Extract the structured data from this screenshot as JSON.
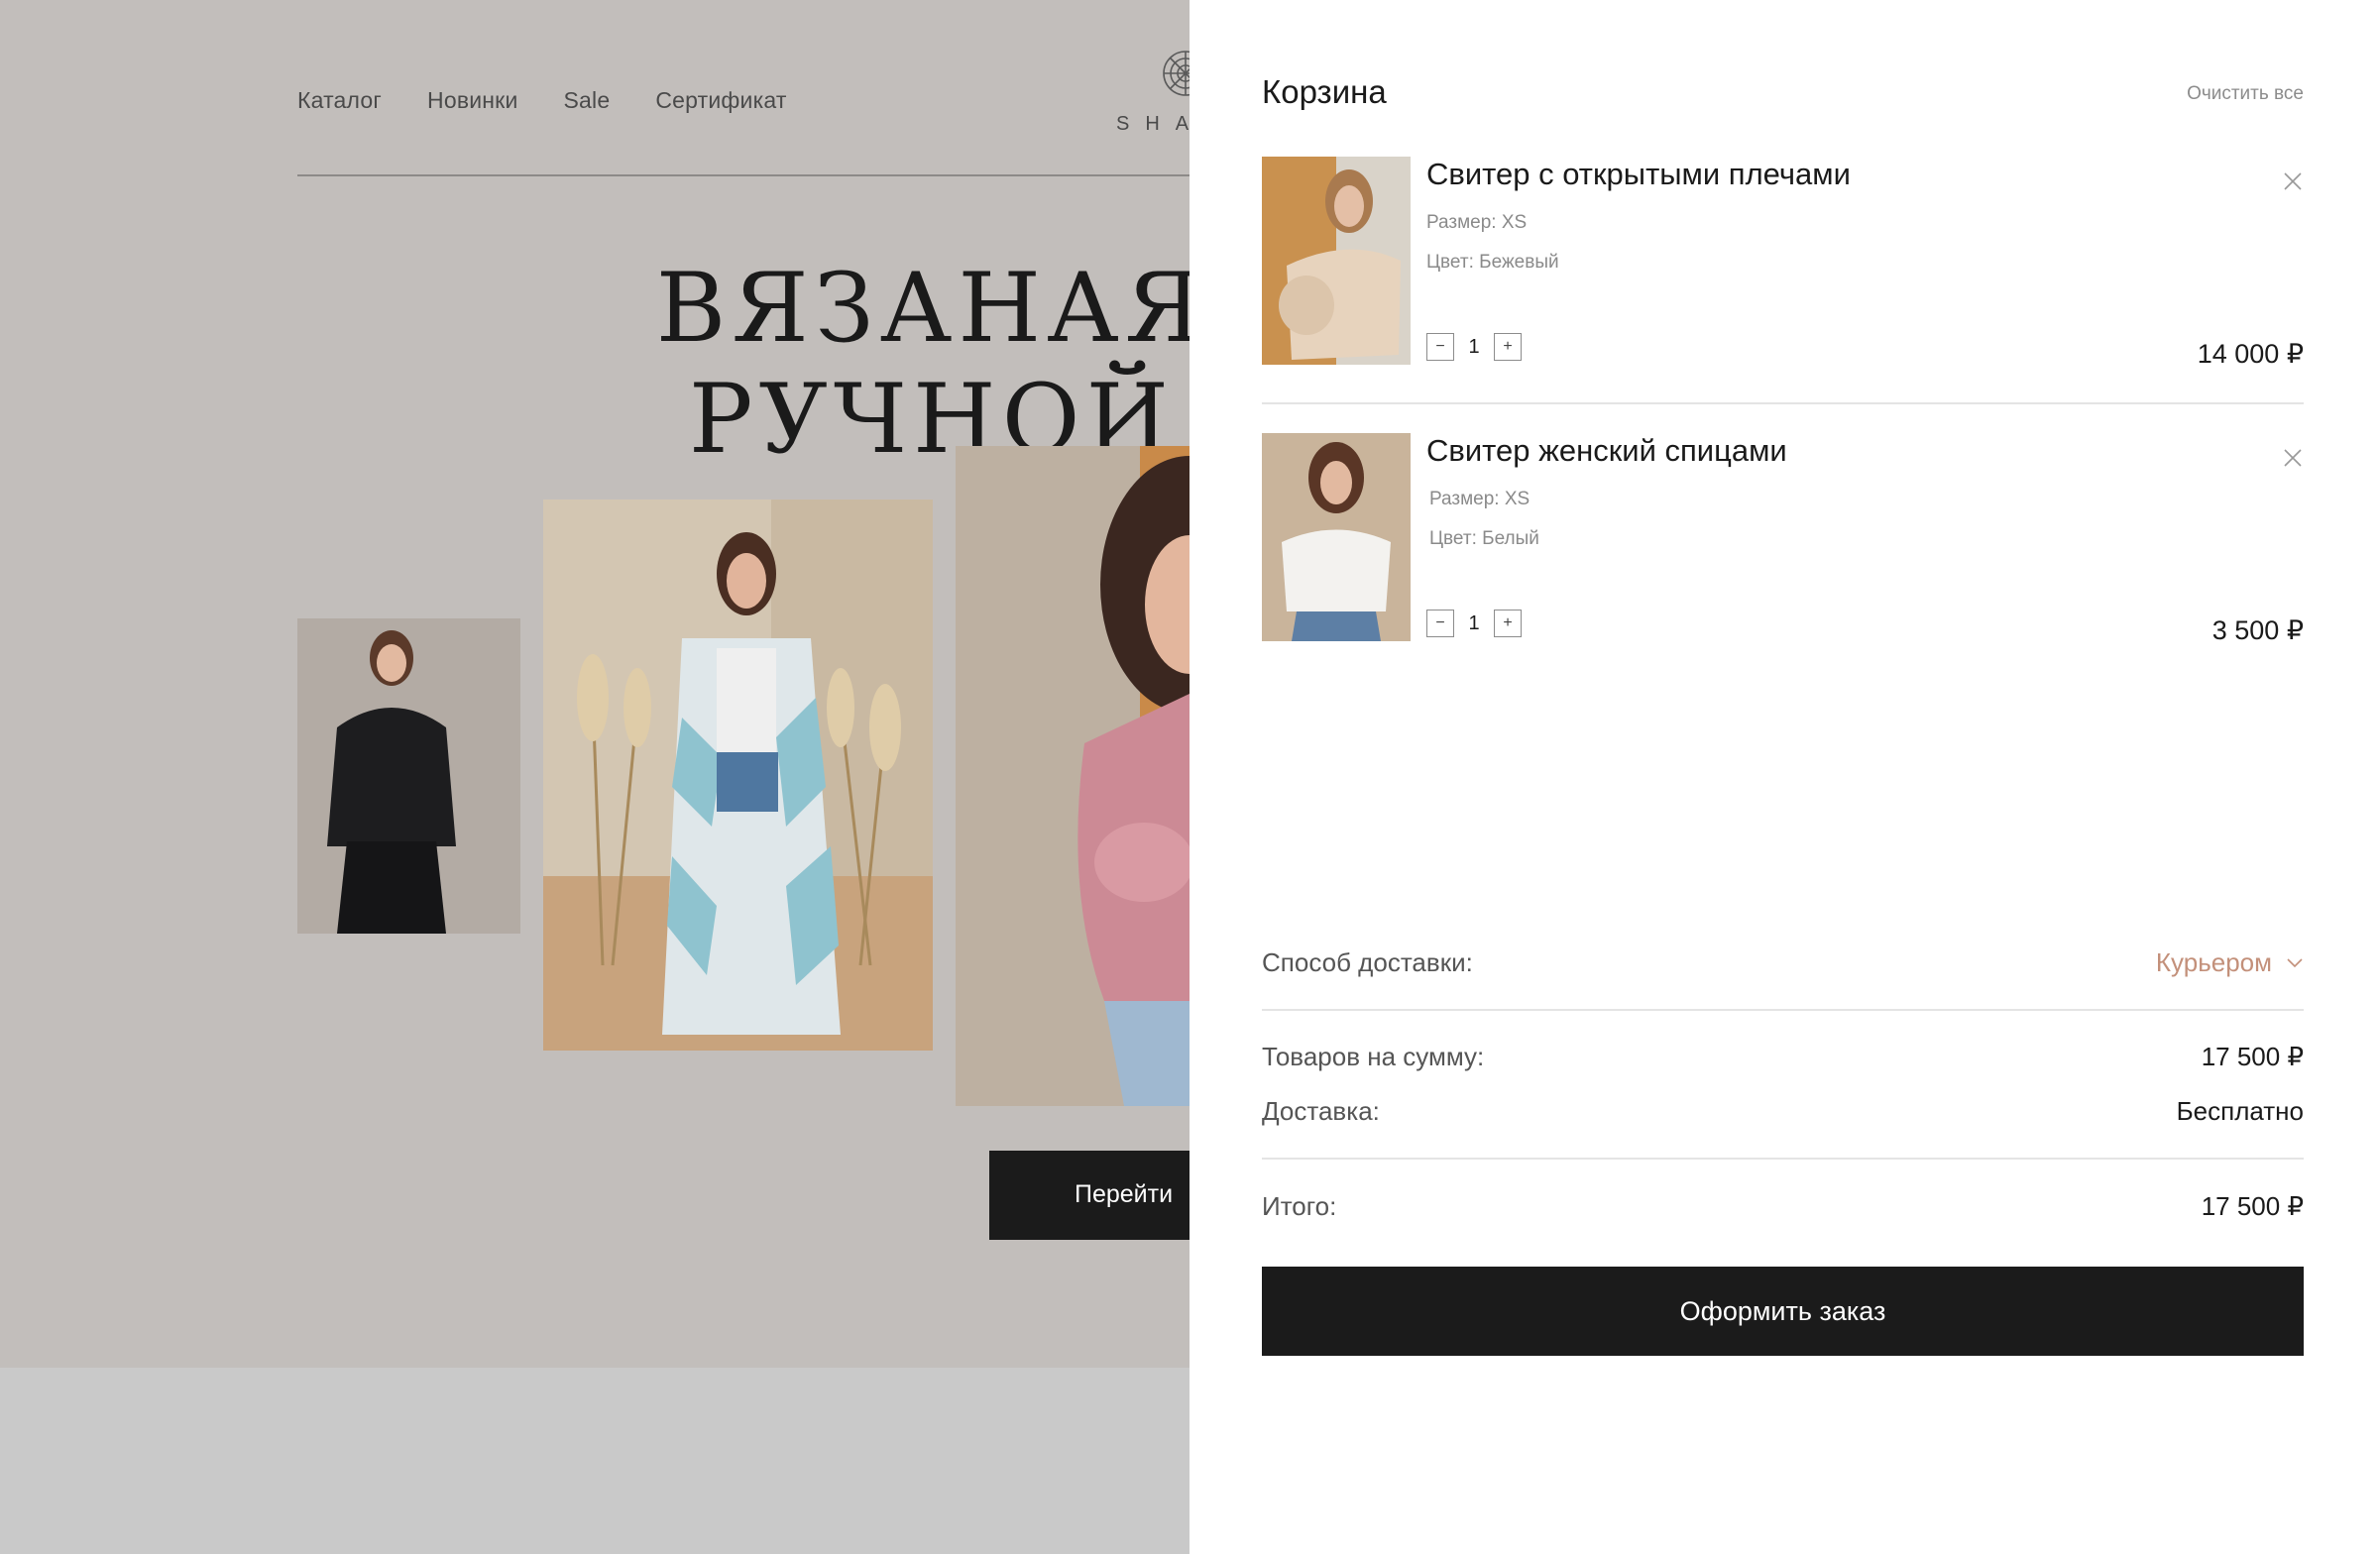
{
  "nav": {
    "items": [
      "Каталог",
      "Новинки",
      "Sale",
      "Сертификат"
    ]
  },
  "brand": {
    "logo_text": "SHA"
  },
  "hero": {
    "line1": "ВЯЗАНАЯ",
    "line2": "РУЧНОЙ",
    "cta": "Перейти"
  },
  "cart": {
    "title": "Корзина",
    "clear_all": "Очистить все",
    "items": [
      {
        "name": "Свитер с открытыми плечами",
        "size": "Размер: XS",
        "color": "Цвет: Бежевый",
        "qty": "1",
        "price": "14 000 ₽"
      },
      {
        "name": "Свитер женский спицами",
        "size": "Размер: XS",
        "color": "Цвет: Белый",
        "qty": "1",
        "price": "3 500 ₽"
      }
    ],
    "qty_minus": "−",
    "qty_plus": "+",
    "delivery_label": "Способ доставки:",
    "delivery_value": "Курьером",
    "goods_sum_label": "Товаров на сумму:",
    "goods_sum_value": "17 500 ₽",
    "shipping_label": "Доставка:",
    "shipping_value": "Бесплатно",
    "total_label": "Итого:",
    "total_value": "17 500 ₽",
    "checkout": "Оформить заказ"
  },
  "colors": {
    "page_bg": "#c2bebb",
    "accent": "#c3907a",
    "button": "#1b1b1b"
  }
}
